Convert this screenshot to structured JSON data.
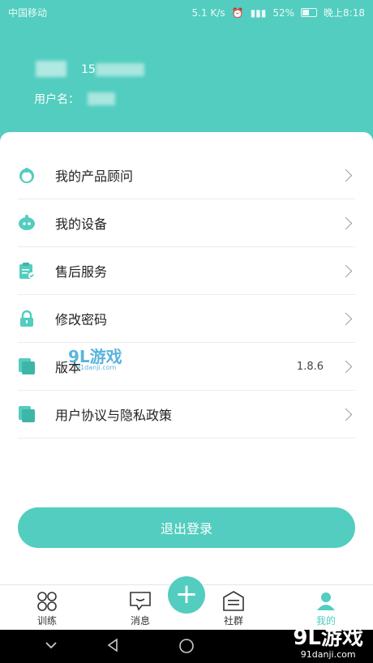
{
  "status_bar": {
    "carrier": "中国移动",
    "speed": "5.1 K/s",
    "battery": "52%",
    "time": "晚上8:18"
  },
  "profile": {
    "phone": "15",
    "username_label": "用户名："
  },
  "menu": [
    {
      "icon": "advisor-icon",
      "label": "我的产品顾问",
      "value": ""
    },
    {
      "icon": "device-icon",
      "label": "我的设备",
      "value": ""
    },
    {
      "icon": "service-icon",
      "label": "售后服务",
      "value": ""
    },
    {
      "icon": "lock-icon",
      "label": "修改密码",
      "value": ""
    },
    {
      "icon": "version-icon",
      "label": "版本",
      "value": "1.8.6"
    },
    {
      "icon": "agreement-icon",
      "label": "用户协议与隐私政策",
      "value": ""
    }
  ],
  "logout_label": "退出登录",
  "tabs": [
    {
      "label": "训练"
    },
    {
      "label": "消息"
    },
    {
      "label": "社群"
    },
    {
      "label": "我的"
    }
  ],
  "watermark": {
    "brand": "9L游戏",
    "site": "91danji.com"
  },
  "colors": {
    "accent": "#52cdbf"
  }
}
